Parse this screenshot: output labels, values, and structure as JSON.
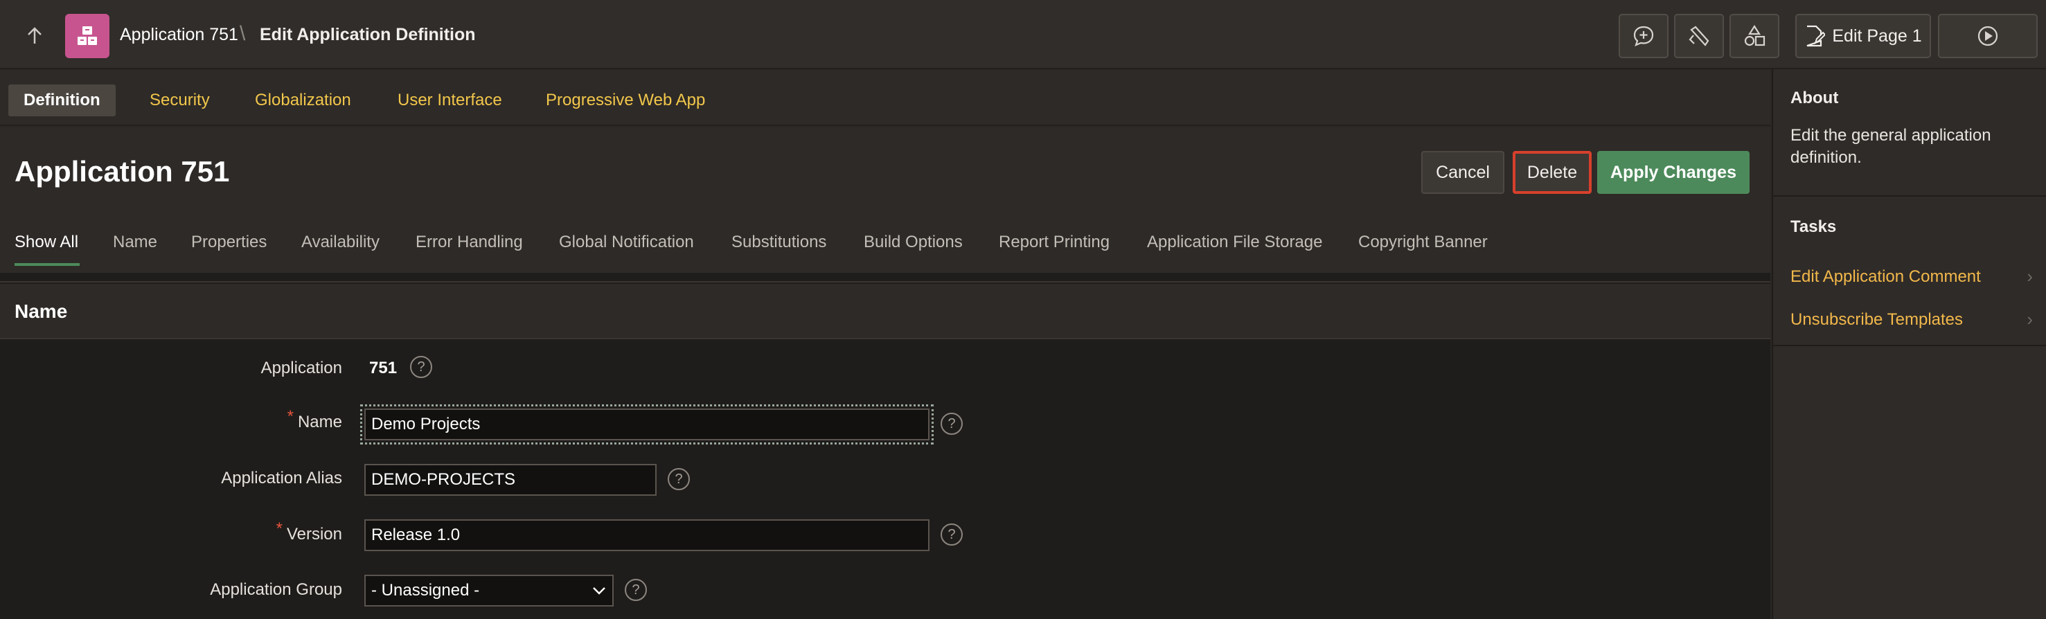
{
  "header": {
    "app_name": "Application 751",
    "separator": "\\",
    "page_name": "Edit Application Definition",
    "edit_page_label": "Edit Page 1",
    "icons": [
      "up-arrow-icon",
      "apps-icon",
      "comment-add-icon",
      "developer-tools-icon",
      "shapes-icon",
      "page-edit-icon",
      "run-icon"
    ]
  },
  "main_tabs": [
    {
      "label": "Definition",
      "active": true
    },
    {
      "label": "Security"
    },
    {
      "label": "Globalization"
    },
    {
      "label": "User Interface"
    },
    {
      "label": "Progressive Web App"
    }
  ],
  "page": {
    "title": "Application 751",
    "buttons": {
      "cancel": "Cancel",
      "delete": "Delete",
      "apply": "Apply Changes"
    }
  },
  "section_tabs": [
    {
      "label": "Show All",
      "active": true
    },
    {
      "label": "Name"
    },
    {
      "label": "Properties"
    },
    {
      "label": "Availability"
    },
    {
      "label": "Error Handling"
    },
    {
      "label": "Global Notification"
    },
    {
      "label": "Substitutions"
    },
    {
      "label": "Build Options"
    },
    {
      "label": "Report Printing"
    },
    {
      "label": "Application File Storage"
    },
    {
      "label": "Copyright Banner"
    }
  ],
  "region": {
    "title": "Name",
    "fields": {
      "application": {
        "label": "Application",
        "value": "751"
      },
      "name": {
        "label": "Name",
        "required_mark": "*",
        "value": "Demo Projects"
      },
      "alias": {
        "label": "Application Alias",
        "value": "DEMO-PROJECTS"
      },
      "version": {
        "label": "Version",
        "required_mark": "*",
        "value": "Release 1.0"
      },
      "group": {
        "label": "Application Group",
        "value": "- Unassigned -"
      }
    },
    "help_glyph": "?"
  },
  "sidebar": {
    "about_title": "About",
    "about_text": "Edit the general application definition.",
    "tasks_title": "Tasks",
    "tasks": [
      {
        "label": "Edit Application Comment"
      },
      {
        "label": "Unsubscribe Templates"
      }
    ]
  },
  "colors": {
    "accent_link": "#f2b84b",
    "apply_button": "#4d8a5b",
    "delete_highlight": "#d6402c",
    "app_icon": "#c7548f",
    "required": "#e5533d"
  }
}
